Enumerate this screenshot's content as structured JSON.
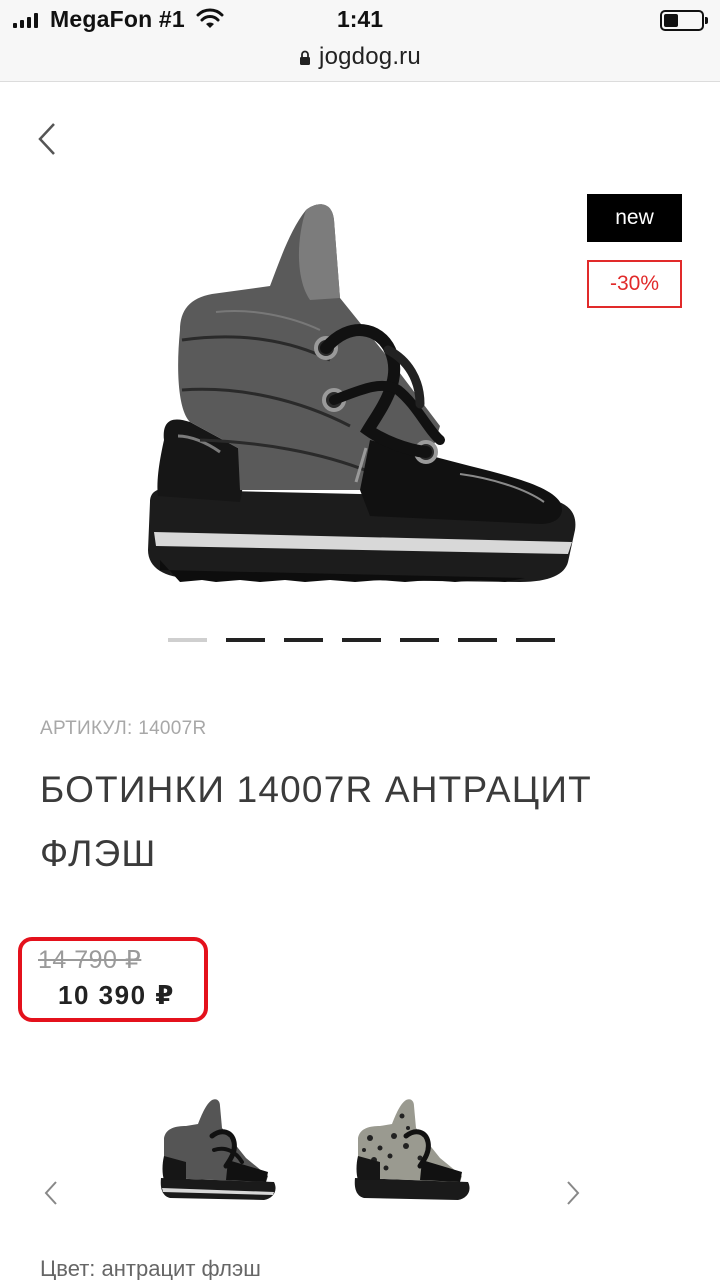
{
  "status_bar": {
    "carrier": "MegaFon #1",
    "time": "1:41",
    "battery_level": 0.3
  },
  "browser": {
    "url": "jogdog.ru"
  },
  "product": {
    "badges": {
      "new": "new",
      "sale": "-30%"
    },
    "gallery": {
      "slide_count": 7,
      "active_index": 0
    },
    "sku": "АРТИКУЛ: 14007R",
    "title": "БОТИНКИ 14007R АНТРАЦИТ ФЛЭШ",
    "price": {
      "old": "14 790 ₽",
      "current": "10 390 ₽",
      "highlight_color": "#e4111c"
    },
    "color_label": "Цвет: антрацит флэш"
  },
  "colors": {
    "sale": "#e12a2a",
    "badge_bg": "#000000"
  }
}
